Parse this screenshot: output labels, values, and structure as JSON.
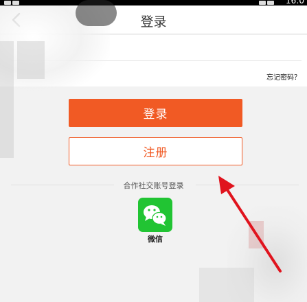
{
  "status_bar": {
    "time": "16:0"
  },
  "nav": {
    "title": "登录"
  },
  "form": {
    "forgot_password": "忘记密码？"
  },
  "actions": {
    "login_label": "登录",
    "register_label": "注册"
  },
  "social": {
    "section_label": "合作社交账号登录",
    "wechat_label": "微信"
  },
  "colors": {
    "accent": "#f15a24",
    "wechat": "#21c433",
    "annotation": "#e0141e"
  }
}
